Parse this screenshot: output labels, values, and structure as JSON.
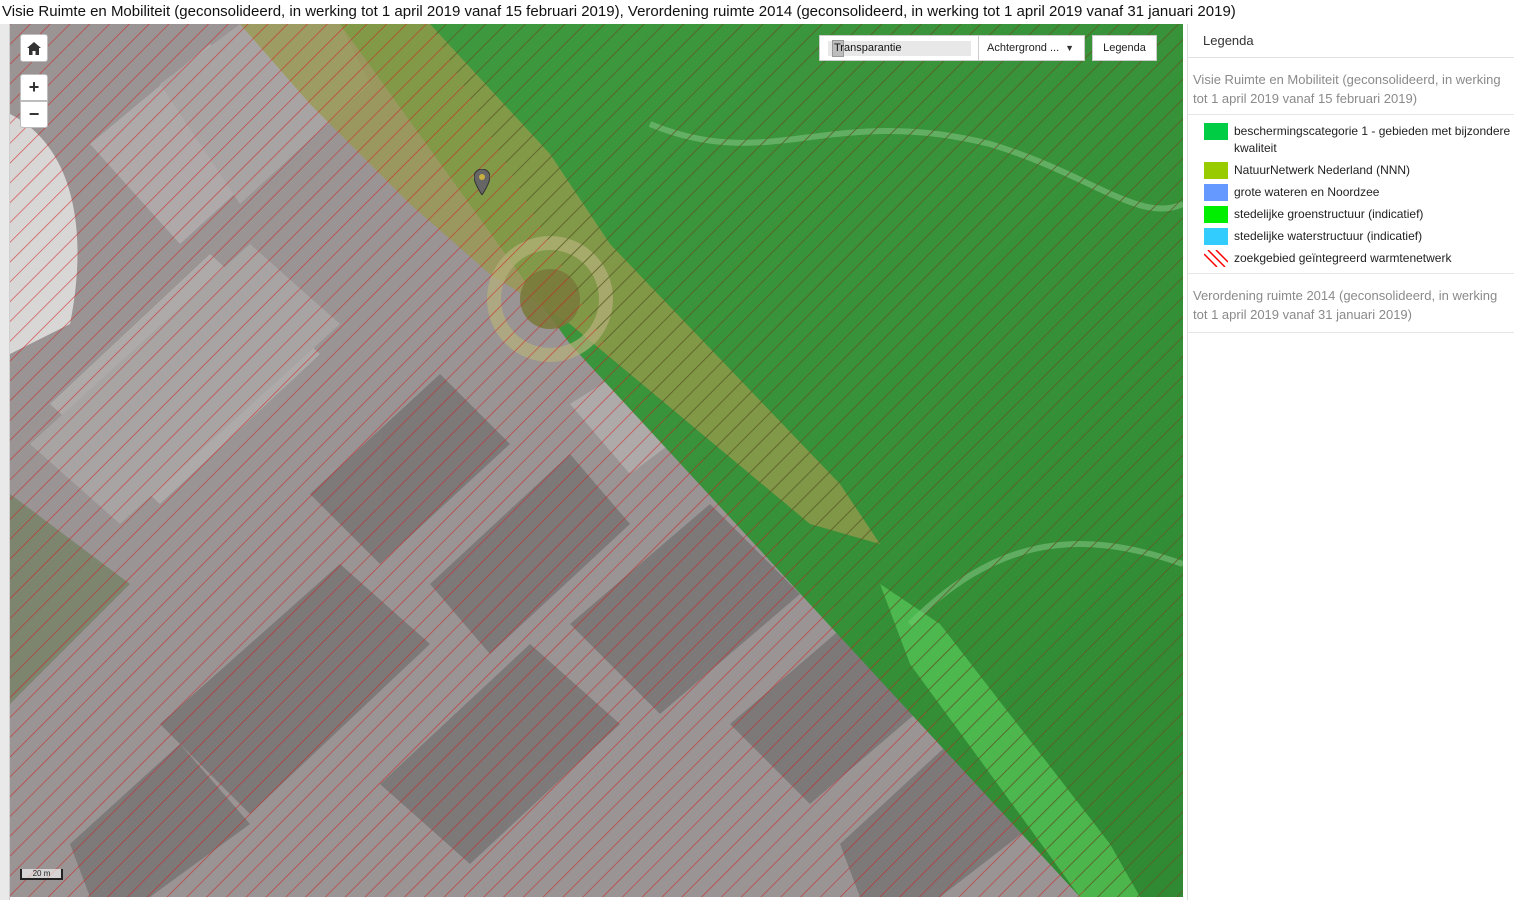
{
  "page": {
    "title": "Visie Ruimte en Mobiliteit (geconsolideerd, in werking tot 1 april 2019 vanaf 15 februari 2019), Verordening ruimte 2014 (geconsolideerd, in werking tot 1 april 2019 vanaf 31 januari 2019)"
  },
  "map": {
    "controls": {
      "home_icon": "home-icon",
      "zoom_in_label": "+",
      "zoom_out_label": "−"
    },
    "toolbar": {
      "transparency_label": "Transparantie",
      "background_label": "Achtergrond ...",
      "legend_button_label": "Legenda"
    },
    "scale_label": "20 m"
  },
  "legend": {
    "header": "Legenda",
    "sections": [
      {
        "title": "Visie Ruimte en Mobiliteit (geconsolideerd, in werking tot 1 april 2019 vanaf 15 februari 2019)",
        "items": [
          {
            "label": "beschermingscategorie 1 - gebieden met bijzondere kwaliteit",
            "color": "#00cc44"
          },
          {
            "label": "NatuurNetwerk Nederland (NNN)",
            "color": "#99cc00"
          },
          {
            "label": "grote wateren en Noordzee",
            "color": "#6699ff"
          },
          {
            "label": "stedelijke groenstructuur (indicatief)",
            "color": "#00ee00"
          },
          {
            "label": "stedelijke waterstructuur (indicatief)",
            "color": "#33ccff"
          },
          {
            "label": "zoekgebied geïntegreerd warmtenetwerk",
            "color": "#ff0000",
            "pattern": "red-diagonal-hatch"
          }
        ]
      },
      {
        "title": "Verordening ruimte 2014 (geconsolideerd, in werking tot 1 april 2019 vanaf 31 januari 2019)",
        "items": []
      }
    ]
  }
}
